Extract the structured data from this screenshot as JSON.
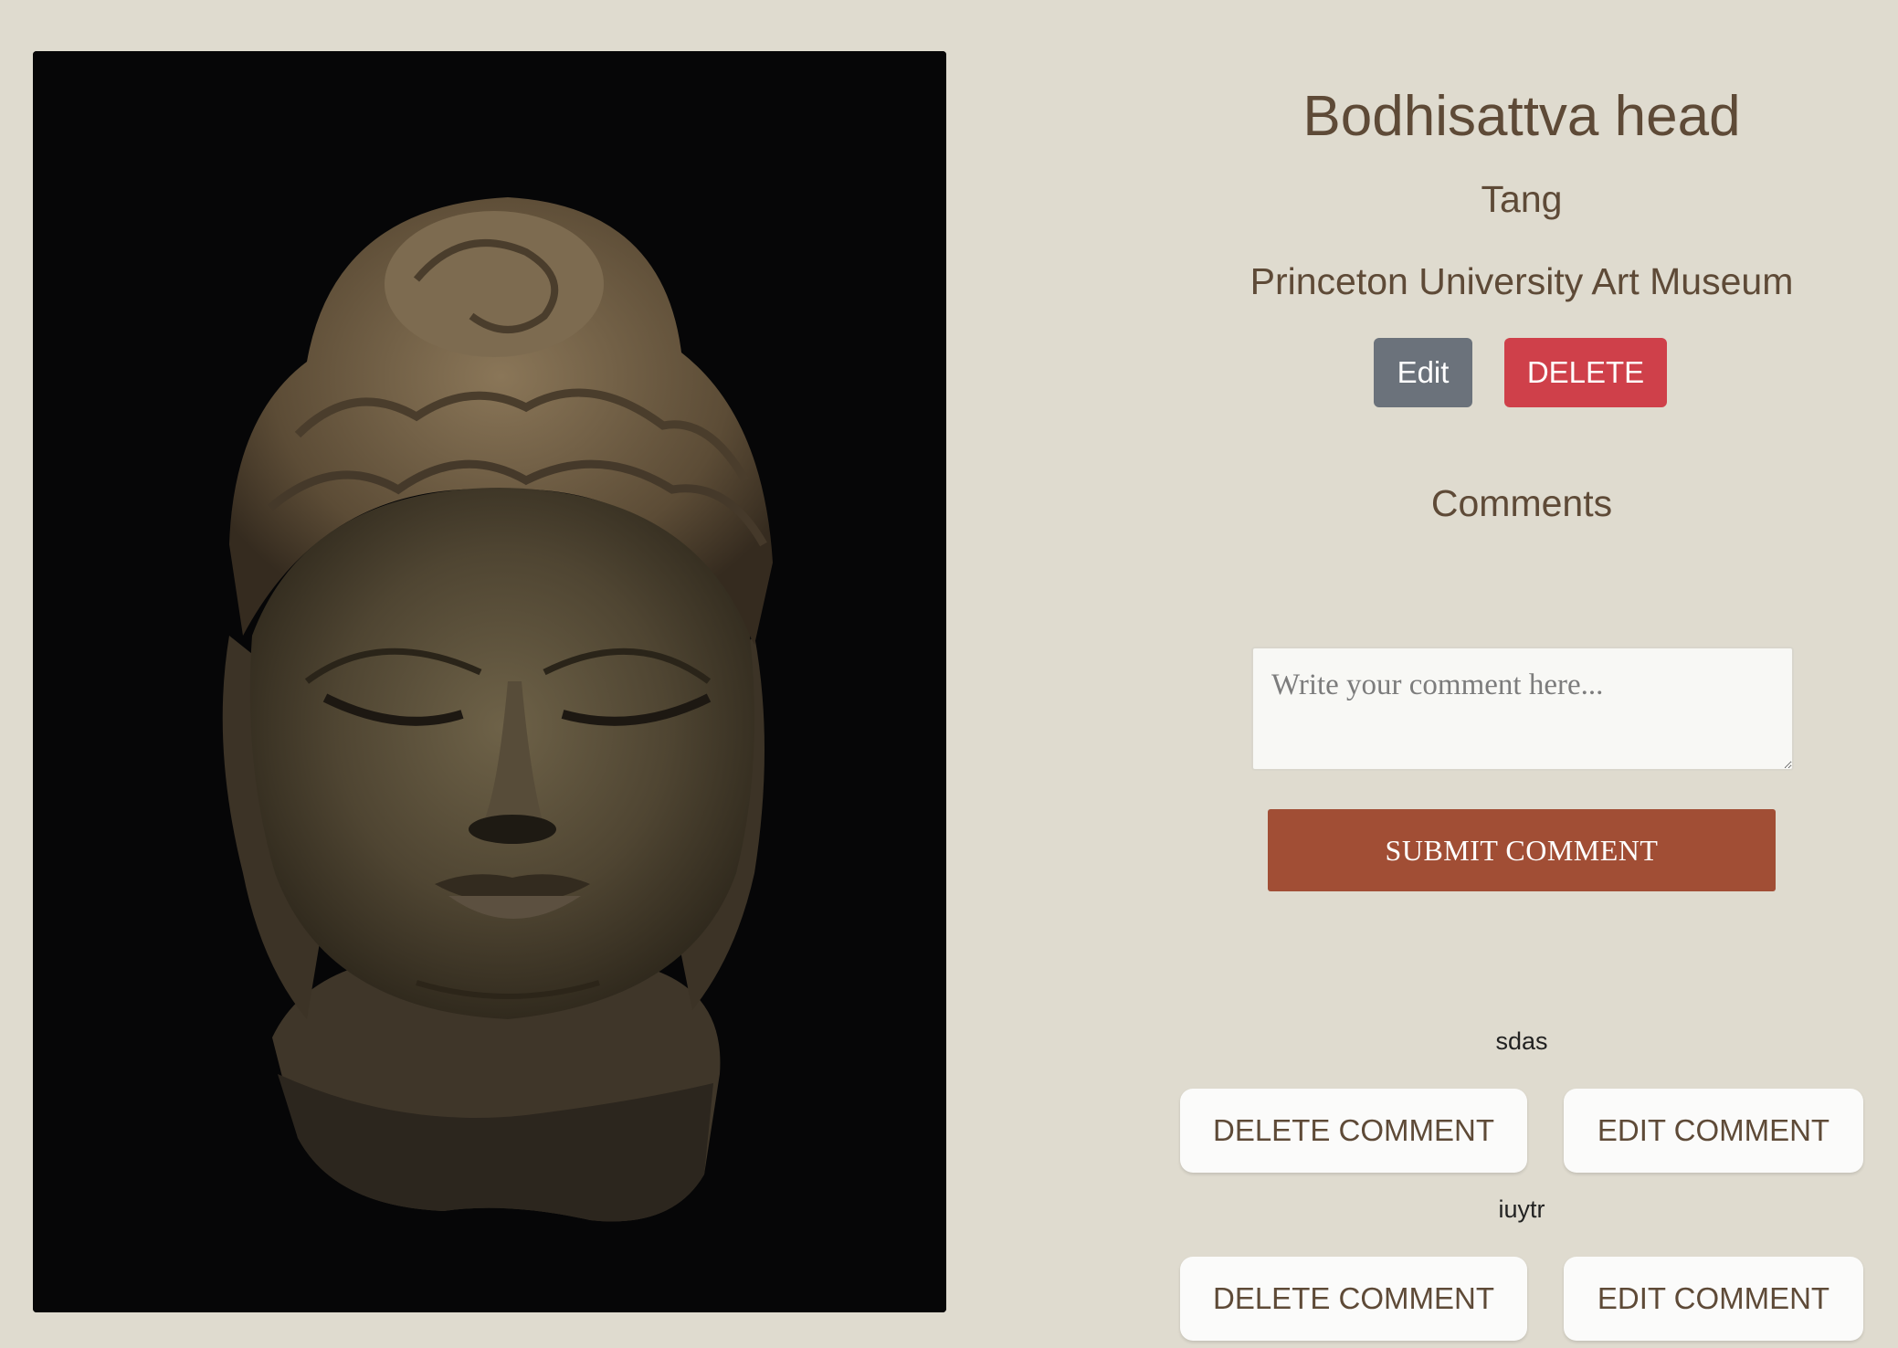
{
  "artwork": {
    "title": "Bodhisattva head",
    "period": "Tang",
    "museum": "Princeton University Art Museum",
    "edit_label": "Edit",
    "delete_label": "DELETE"
  },
  "comments": {
    "heading": "Comments",
    "input_placeholder": "Write your comment here...",
    "submit_label": "SUBMIT COMMENT",
    "items": [
      {
        "text": "sdas",
        "delete_label": "DELETE COMMENT",
        "edit_label": "EDIT COMMENT"
      },
      {
        "text": "iuytr",
        "delete_label": "DELETE COMMENT",
        "edit_label": "EDIT COMMENT"
      }
    ]
  },
  "colors": {
    "background": "#dfdbcf",
    "text": "#5e4a37",
    "edit_button": "#6b727b",
    "delete_button": "#cf404a",
    "submit_button": "#a14e35"
  }
}
